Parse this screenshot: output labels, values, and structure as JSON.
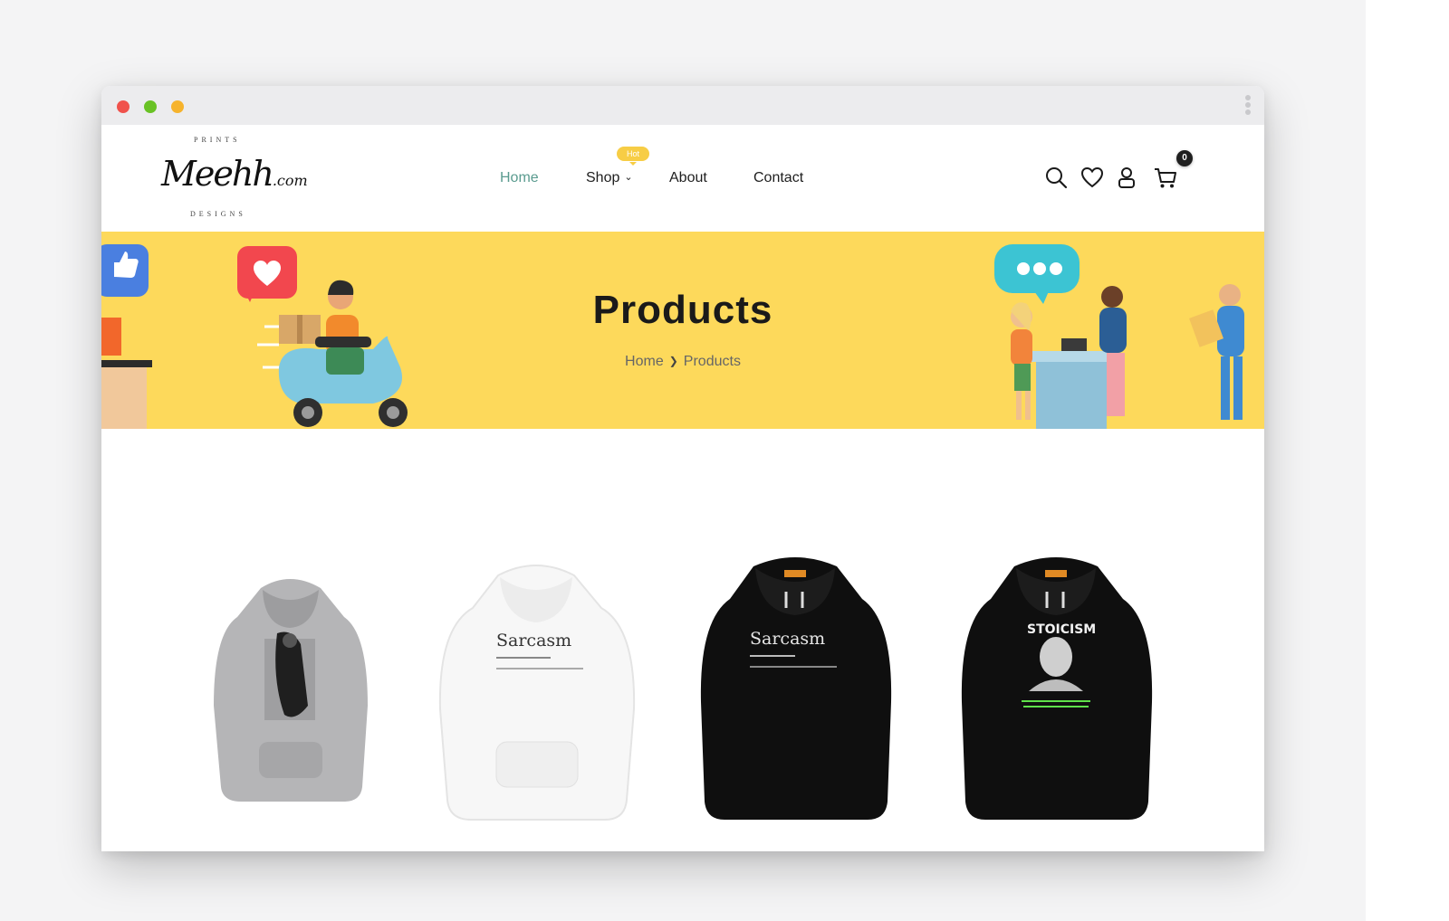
{
  "window": {
    "dots": [
      "close",
      "minimize",
      "maximize"
    ]
  },
  "logo": {
    "top_text": "PRINTS",
    "script_text": "Meehh",
    "script_suffix": ".com",
    "bottom_text": "DESIGNS"
  },
  "nav": {
    "items": [
      {
        "label": "Home",
        "active": true
      },
      {
        "label": "Shop",
        "has_dropdown": true,
        "badge": "Hot"
      },
      {
        "label": "About"
      },
      {
        "label": "Contact"
      }
    ],
    "icons": [
      "search-icon",
      "heart-icon",
      "user-icon",
      "cart-icon"
    ],
    "cart_count": "0"
  },
  "banner": {
    "title": "Products",
    "breadcrumb": [
      "Home",
      "Products"
    ],
    "background": "#fdd95b"
  },
  "products": [
    {
      "color": "grey",
      "print_text": ""
    },
    {
      "color": "white",
      "print_text": "Sarcasm"
    },
    {
      "color": "black",
      "print_text": "Sarcasm"
    },
    {
      "color": "black",
      "print_text": "STOICISM"
    }
  ],
  "colors": {
    "accent": "#5a9b8f",
    "badge": "#f7cd45"
  }
}
